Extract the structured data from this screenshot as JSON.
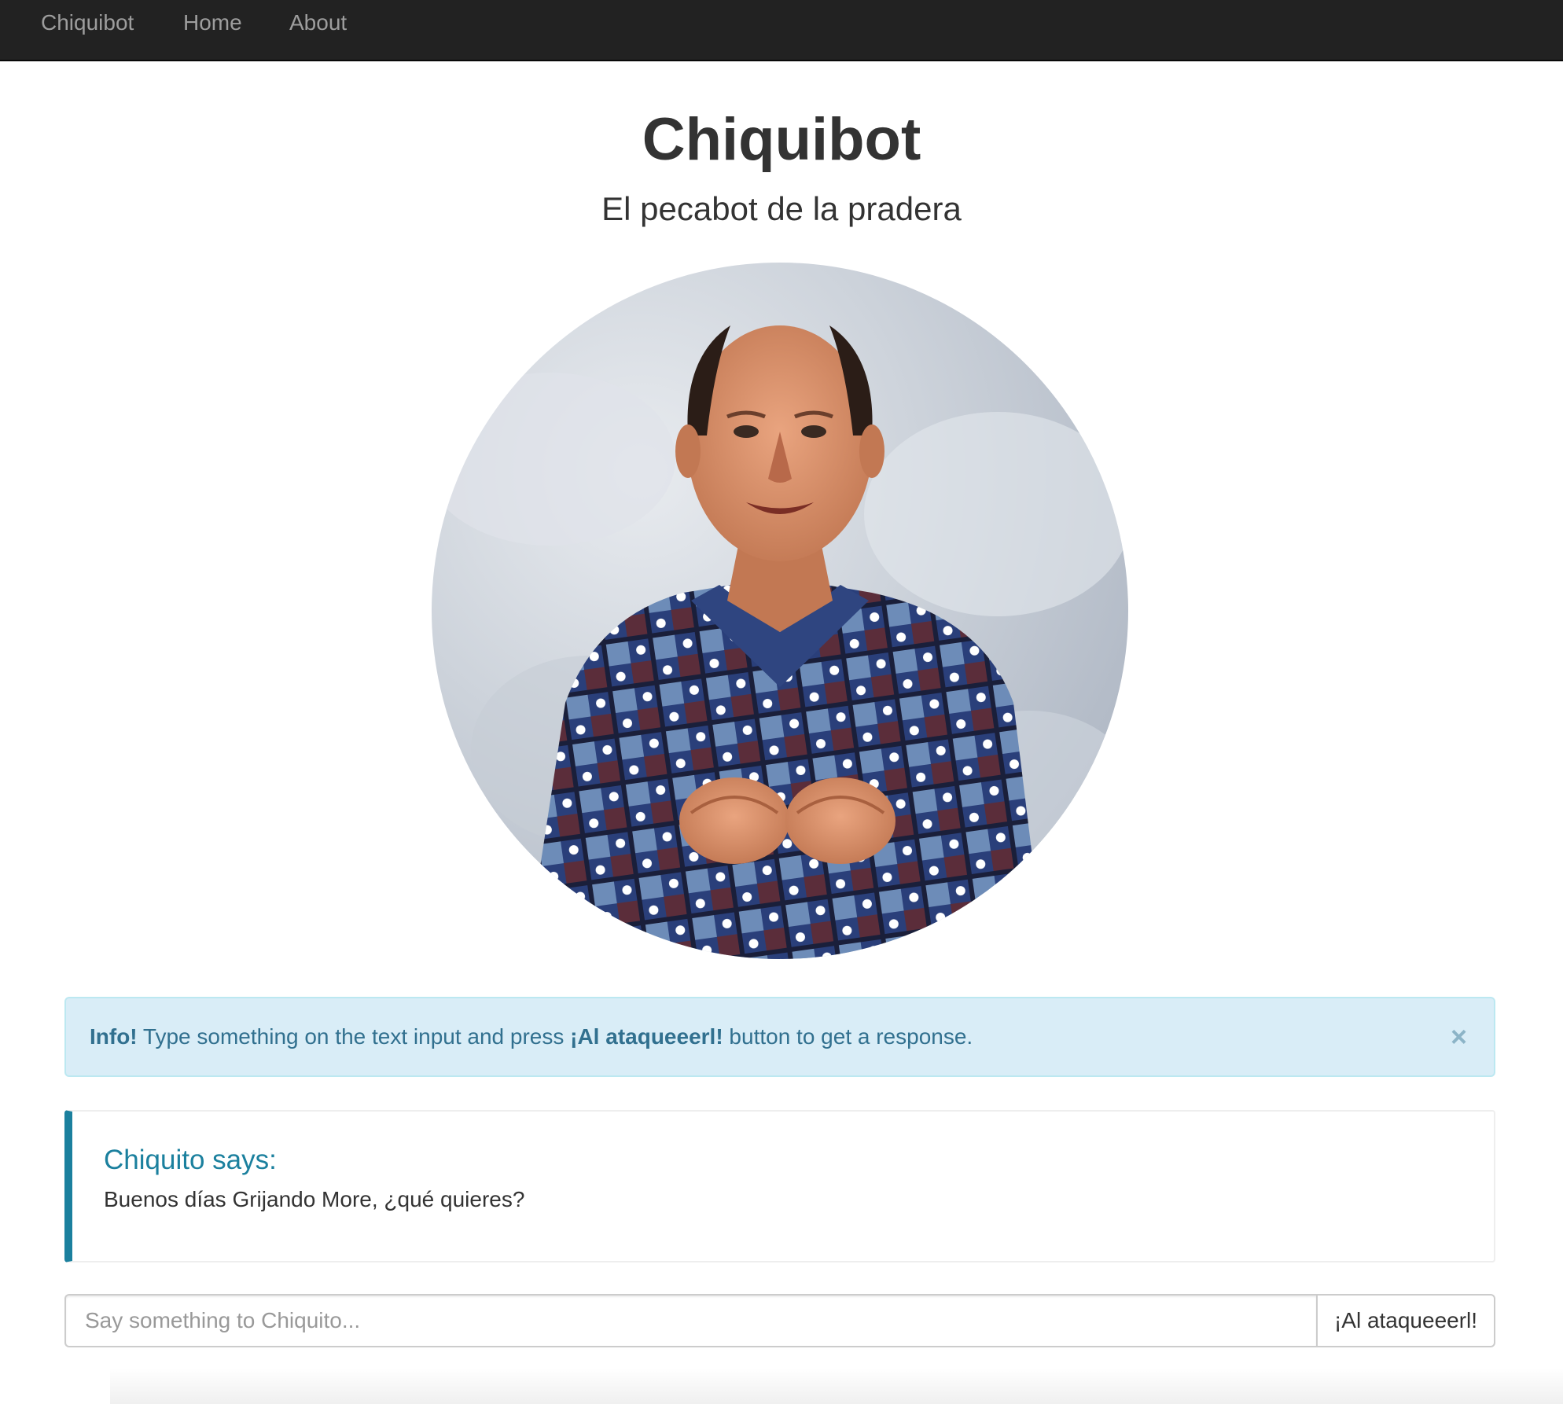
{
  "navbar": {
    "brand": "Chiquibot",
    "items": [
      {
        "label": "Home"
      },
      {
        "label": "About"
      }
    ]
  },
  "header": {
    "title": "Chiquibot",
    "subtitle": "El pecabot de la pradera"
  },
  "alert": {
    "strong": "Info!",
    "text_before": " Type something on the text input and press ",
    "button_ref": "¡Al ataqueeerl!",
    "text_after": " button to get a response.",
    "close_symbol": "×"
  },
  "callout": {
    "title": "Chiquito says:",
    "message": "Buenos días Grijando More, ¿qué quieres?"
  },
  "chat": {
    "placeholder": "Say something to Chiquito...",
    "value": "",
    "send_label": "¡Al ataqueeerl!"
  },
  "colors": {
    "navbar_bg": "#222222",
    "nav_text": "#9d9d9d",
    "alert_bg": "#d9edf7",
    "alert_text": "#31708f",
    "callout_accent": "#1b809e"
  }
}
